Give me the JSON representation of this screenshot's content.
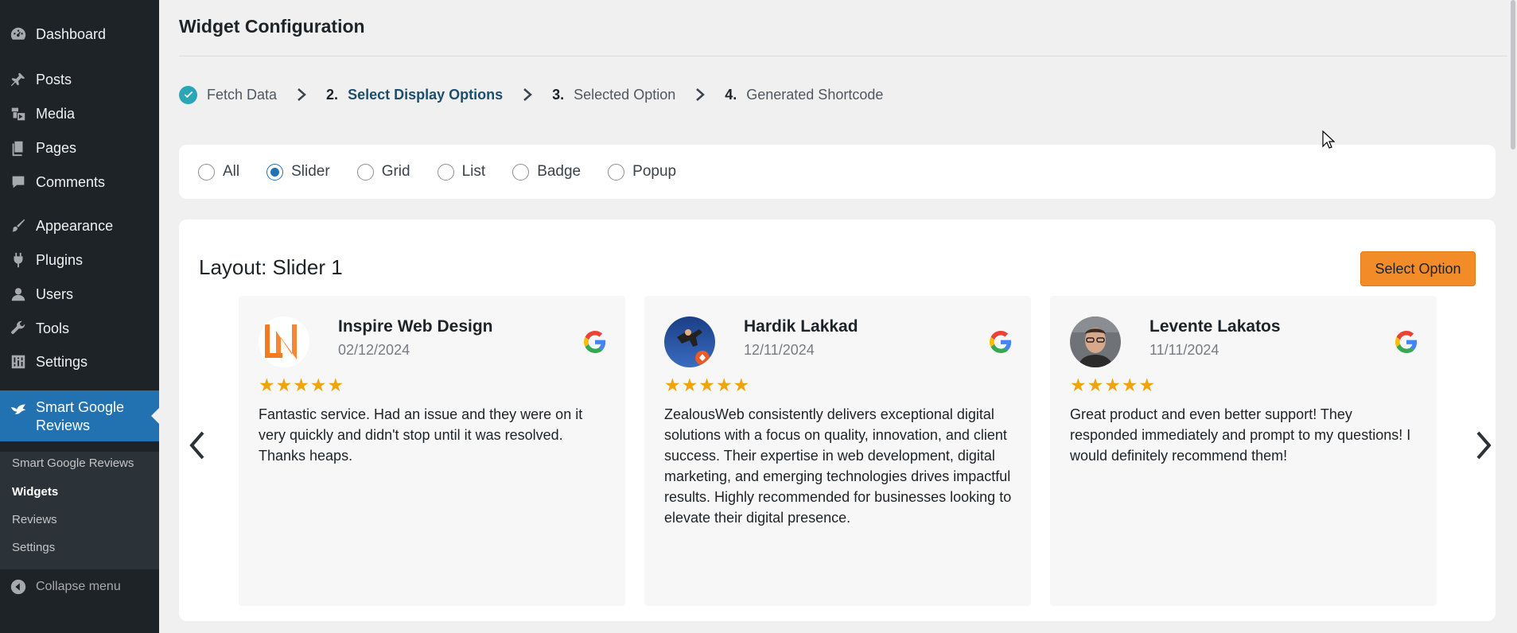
{
  "sidebar": {
    "items": [
      {
        "label": "Dashboard",
        "icon": "dashboard-icon"
      },
      {
        "label": "Posts",
        "icon": "pin-icon"
      },
      {
        "label": "Media",
        "icon": "media-icon"
      },
      {
        "label": "Pages",
        "icon": "pages-icon"
      },
      {
        "label": "Comments",
        "icon": "comment-icon"
      },
      {
        "label": "Appearance",
        "icon": "brush-icon"
      },
      {
        "label": "Plugins",
        "icon": "plugin-icon"
      },
      {
        "label": "Users",
        "icon": "user-icon"
      },
      {
        "label": "Tools",
        "icon": "wrench-icon"
      },
      {
        "label": "Settings",
        "icon": "settings-icon"
      }
    ],
    "active": {
      "label": "Smart Google Reviews",
      "icon": "bird-icon"
    },
    "submenu": [
      "Smart Google Reviews",
      "Widgets",
      "Reviews",
      "Settings"
    ],
    "submenu_current": "Widgets",
    "collapse_label": "Collapse menu"
  },
  "page": {
    "title": "Widget Configuration"
  },
  "steps": [
    {
      "num": "",
      "label": "Fetch Data",
      "status": "done"
    },
    {
      "num": "2.",
      "label": "Select Display Options",
      "status": "current"
    },
    {
      "num": "3.",
      "label": "Selected Option",
      "status": "pending"
    },
    {
      "num": "4.",
      "label": "Generated Shortcode",
      "status": "pending"
    }
  ],
  "display_options": [
    "All",
    "Slider",
    "Grid",
    "List",
    "Badge",
    "Popup"
  ],
  "display_option_selected": "Slider",
  "layout": {
    "title": "Layout: Slider 1",
    "button_label": "Select Option"
  },
  "reviews": [
    {
      "name": "Inspire Web Design",
      "date": "02/12/2024",
      "stars": "★★★★★",
      "text": "Fantastic service. Had an issue and they were on it very quickly and didn't stop until it was resolved. Thanks heaps."
    },
    {
      "name": "Hardik Lakkad",
      "date": "12/11/2024",
      "stars": "★★★★★",
      "text": "ZealousWeb consistently delivers exceptional digital solutions with a focus on quality, innovation, and client success. Their expertise in web development, digital marketing, and emerging technologies drives impactful results. Highly recommended for businesses looking to elevate their digital presence."
    },
    {
      "name": "Levente Lakatos",
      "date": "11/11/2024",
      "stars": "★★★★★",
      "text": "Great product and even better support! They responded immediately and prompt to my questions! I would definitely recommend them!"
    }
  ],
  "colors": {
    "sidebar_bg": "#1d2327",
    "active_menu": "#2271b1",
    "accent_button": "#f28c28",
    "star": "#f0a30a",
    "step_current": "#1d4e6b",
    "check": "#2ba5b8"
  }
}
